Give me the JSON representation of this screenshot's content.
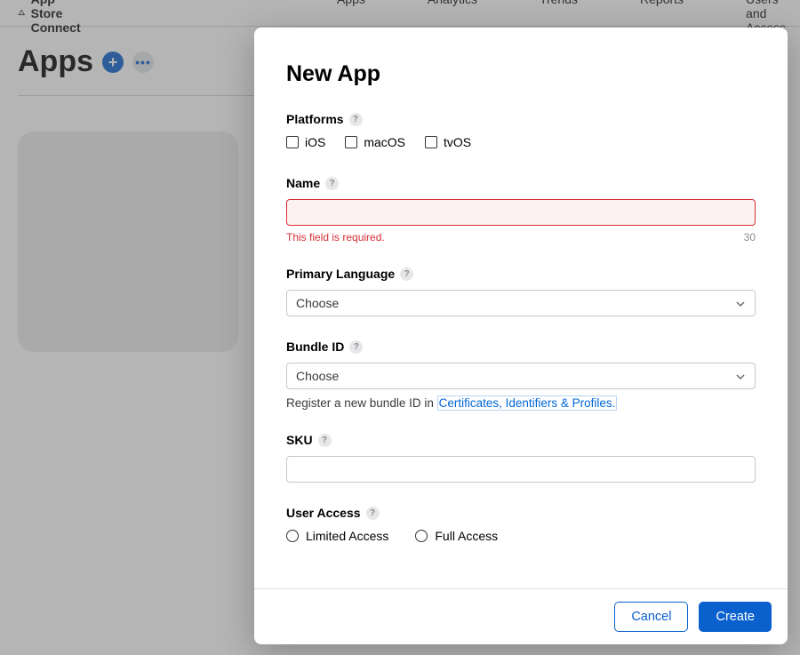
{
  "header": {
    "brand": "App Store Connect",
    "nav": [
      "Apps",
      "Analytics",
      "Trends",
      "Reports",
      "Users and Access"
    ]
  },
  "page": {
    "title": "Apps"
  },
  "modal": {
    "title": "New App",
    "platforms": {
      "label": "Platforms",
      "options": [
        "iOS",
        "macOS",
        "tvOS"
      ]
    },
    "name": {
      "label": "Name",
      "value": "",
      "error": "This field is required.",
      "counter": "30"
    },
    "language": {
      "label": "Primary Language",
      "selected": "Choose"
    },
    "bundle": {
      "label": "Bundle ID",
      "selected": "Choose",
      "hint_prefix": "Register a new bundle ID in ",
      "hint_link": "Certificates, Identifiers & Profiles."
    },
    "sku": {
      "label": "SKU",
      "value": ""
    },
    "access": {
      "label": "User Access",
      "options": [
        "Limited Access",
        "Full Access"
      ]
    },
    "actions": {
      "cancel": "Cancel",
      "create": "Create"
    }
  }
}
